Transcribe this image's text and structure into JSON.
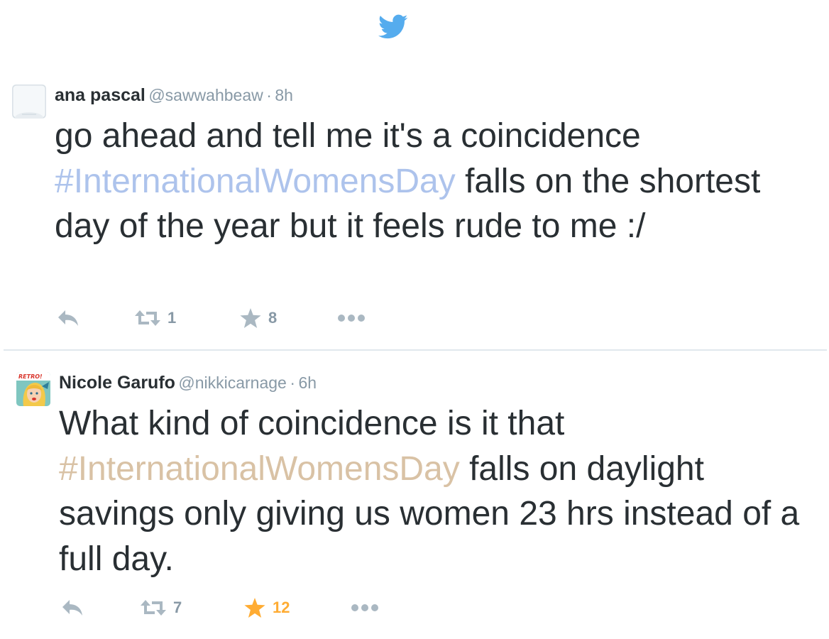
{
  "app": {
    "logo_icon": "twitter-bird-icon",
    "brand_color": "#55acee"
  },
  "tweets": [
    {
      "name": "ana pascal",
      "handle": "@sawwahbeaw",
      "separator": "·",
      "time": "8h",
      "avatar_icon": "default-egg-avatar",
      "text_before": "go ahead and tell me it's a coincidence ",
      "hashtag": "#InternationalWomensDay",
      "text_after": " falls on the shortest day of the year but it feels rude to me :/",
      "hashtag_color": "#adc3ec",
      "retweets": "1",
      "favorites": "8",
      "favorited": false
    },
    {
      "name": "Nicole Garufo",
      "handle": "@nikkicarnage",
      "separator": "·",
      "time": "6h",
      "avatar_icon": "retro-comic-avatar",
      "avatar_text": "RETRO!",
      "text_before": "What kind of coincidence is it that ",
      "hashtag": "#InternationalWomensDay",
      "text_after": " falls on daylight savings only giving us women 23 hrs instead of a full day.",
      "hashtag_color": "#d9c2a5",
      "retweets": "7",
      "favorites": "12",
      "favorited": true,
      "favorite_active_color": "#ffac33"
    }
  ]
}
